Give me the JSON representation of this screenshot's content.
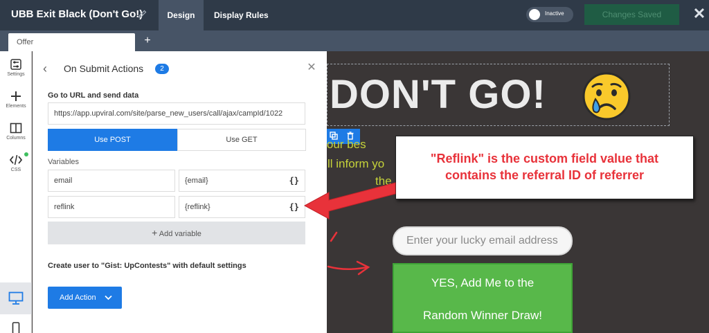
{
  "header": {
    "title": "UBB Exit Black (Don't Go!)",
    "tabs": [
      "Design",
      "Display Rules"
    ],
    "toggle_label": "Inactive",
    "save_label": "Changes Saved",
    "close_glyph": "✕"
  },
  "tabstrip": {
    "tabs": [
      "Offer"
    ],
    "add_glyph": "+"
  },
  "iconbar": {
    "items": [
      {
        "label": "Settings",
        "icon": "settings-icon"
      },
      {
        "label": "Elements",
        "icon": "plus-icon"
      },
      {
        "label": "Columns",
        "icon": "columns-icon"
      },
      {
        "label": "CSS",
        "icon": "code-icon"
      }
    ],
    "devices": [
      "desktop-icon",
      "mobile-icon"
    ]
  },
  "panel": {
    "back_glyph": "‹",
    "title": "On Submit Actions",
    "count": "2",
    "close_glyph": "✕",
    "section_title": "Go to URL and send data",
    "url": "https://app.upviral.com/site/parse_new_users/call/ajax/campId/1022",
    "methods": [
      "Use POST",
      "Use GET"
    ],
    "selected_method": "Use POST",
    "variables_label": "Variables",
    "variables": [
      {
        "name": "email",
        "value": "{email}",
        "picker": "{}"
      },
      {
        "name": "reflink",
        "value": "{reflink}",
        "picker": "{}"
      }
    ],
    "add_variable": "Add variable",
    "create_user": "Create user to \"Gist: UpContests\" with default settings",
    "add_action": "Add Action"
  },
  "preview": {
    "headline": "DON'T GO!",
    "emoji": "crying-face",
    "body_lines": [
      "r your bes",
      "ll inform yo",
      "the"
    ],
    "email_placeholder": "Enter your lucky email address",
    "cta_lines": [
      "YES, Add Me to the",
      "Random Winner Draw!"
    ]
  },
  "annotation": {
    "lines": [
      "\"Reflink\" is the custom field value that",
      "contains the referral ID of referrer"
    ]
  },
  "colors": {
    "topbar": "#2f3a48",
    "accent": "#1e7be5",
    "canvas": "#3a3636",
    "headline_text": "#c6d33a",
    "cta": "#58b84a",
    "annotation": "#e8323a"
  }
}
